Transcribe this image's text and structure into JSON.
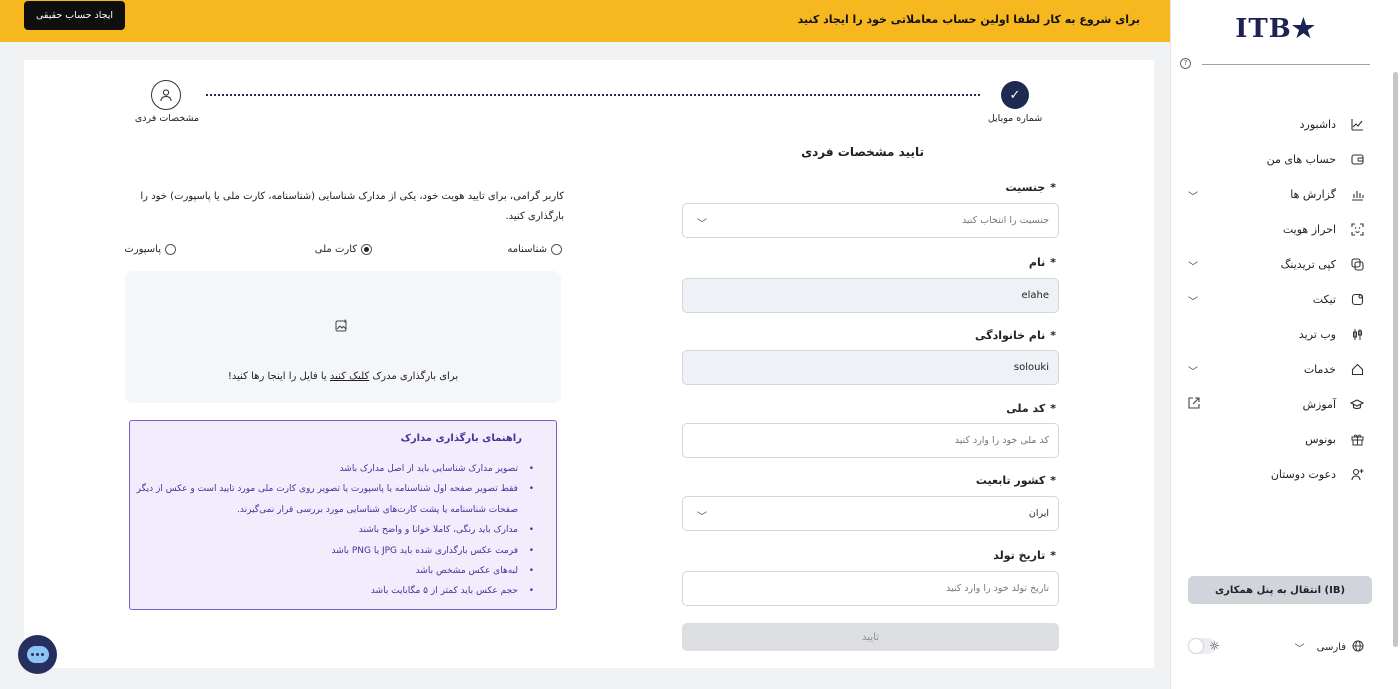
{
  "banner": {
    "message": "برای شروع به کار لطفا اولین حساب معاملاتی خود را ایجاد کنید",
    "create_button": "ایجاد حساب حقیقی"
  },
  "sidebar": {
    "logo_text": "ITB",
    "help_icon": "?",
    "items": [
      {
        "label": "داشبورد",
        "icon": "dashboard-icon",
        "chevron": false
      },
      {
        "label": "حساب های من",
        "icon": "wallet-icon",
        "chevron": false
      },
      {
        "label": "گزارش ها",
        "icon": "chart-icon",
        "chevron": true
      },
      {
        "label": "احراز هویت",
        "icon": "face-scan-icon",
        "chevron": false
      },
      {
        "label": "کپی تریدینگ",
        "icon": "copy-trading-icon",
        "chevron": true
      },
      {
        "label": "تیکت",
        "icon": "ticket-icon",
        "chevron": true
      },
      {
        "label": "وب ترید",
        "icon": "webtrade-icon",
        "chevron": false
      },
      {
        "label": "خدمات",
        "icon": "services-icon",
        "chevron": true
      },
      {
        "label": "آموزش",
        "icon": "education-icon",
        "external": true
      },
      {
        "label": "بونوس",
        "icon": "gift-icon",
        "chevron": false
      },
      {
        "label": "دعوت دوستان",
        "icon": "invite-icon",
        "chevron": false
      }
    ],
    "ib_button": "انتقال به پنل همکاری (IB)",
    "language": "فارسی"
  },
  "stepper": {
    "step1_label": "شماره موبایل",
    "step2_label": "مشخصات فردی"
  },
  "form": {
    "title": "تایید مشخصات فردی",
    "gender_label": "جنسیت",
    "gender_placeholder": "جنسیت را انتخاب کنید",
    "first_name_label": "نام",
    "first_name_value": "elahe",
    "last_name_label": "نام خانوادگی",
    "last_name_value": "solouki",
    "national_code_label": "کد ملی",
    "national_code_placeholder": "کد ملی خود را وارد کنید",
    "country_label": "کشور تابعیت",
    "country_value": "ایران",
    "birthdate_label": "تاریخ تولد",
    "birthdate_placeholder": "تاریخ تولد خود را وارد کنید",
    "submit": "تایید",
    "required_mark": "*"
  },
  "upload": {
    "intro": "کاربر گرامی، برای تایید هویت خود، یکی از مدارک شناسایی (شناسنامه، کارت ملی یا پاسپورت) خود را بارگذاری کنید.",
    "option_birth_cert": "شناسنامه",
    "option_national_card": "کارت ملی",
    "option_passport": "پاسپورت",
    "selected": "کارت ملی",
    "drop_text_pre": "برای بارگذاری مدرک",
    "drop_text_link": "کلیک کنید",
    "drop_text_post": "یا فایل را اینجا رها کنید!"
  },
  "guide": {
    "title": "راهنمای بارگذاری مدارک",
    "items": [
      "تصویر مدارک شناسایی باید از اصل مدارک باشد",
      "فقط تصویر صفحه اول شناسنامه یا پاسپورت یا تصویر روی کارت ملی مورد تایید است و عکس از دیگر صفحات شناسنامه یا پشت کارت‌های شناسایی مورد بررسی قرار نمی‌گیرند.",
      "مدارک باید رنگی، کاملا خوانا و واضح باشند",
      "فرمت عکس بارگذاری شده باید JPG یا PNG باشد",
      "لبه‌های عکس مشخص باشد",
      "حجم عکس باید کمتر از ۵ مگابایت باشد"
    ]
  },
  "colors": {
    "banner": "#f7b81f",
    "primary": "#1e2a52",
    "guide_border": "#7b5fc6",
    "guide_text": "#4b2f9a"
  }
}
